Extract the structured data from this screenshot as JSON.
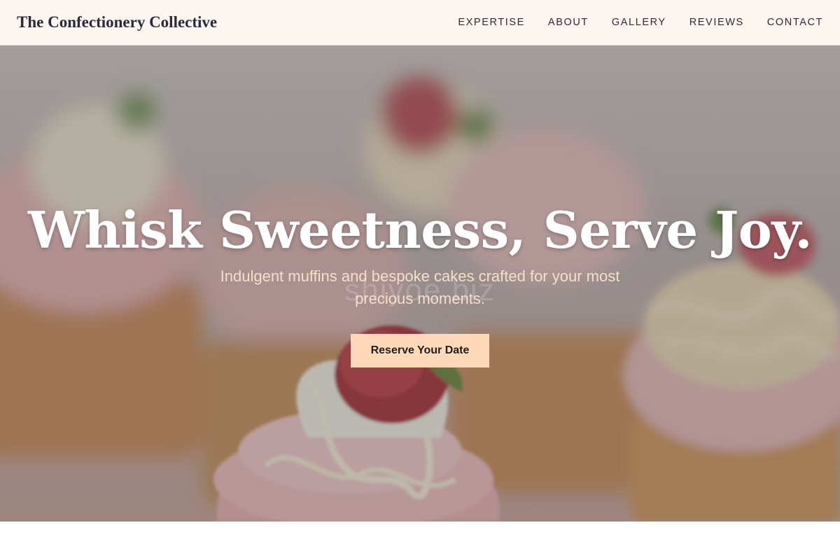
{
  "header": {
    "brand": "The Confectionery Collective",
    "nav": [
      {
        "label": "EXPERTISE"
      },
      {
        "label": "ABOUT"
      },
      {
        "label": "GALLERY"
      },
      {
        "label": "REVIEWS"
      },
      {
        "label": "CONTACT"
      }
    ]
  },
  "hero": {
    "title": "Whisk Sweetness, Serve Joy.",
    "subtitle": "Indulgent muffins and bespoke cakes crafted for your most precious moments.",
    "watermark": "shiyoe biz",
    "cta_label": "Reserve Your Date",
    "image": "cupcakes-strawberry-photo"
  },
  "colors": {
    "nav_background": "#fdf5f0",
    "brand_text": "#2a2b3a",
    "cta_background": "#ffd8b8",
    "subtitle_text": "#f6dfc9"
  }
}
